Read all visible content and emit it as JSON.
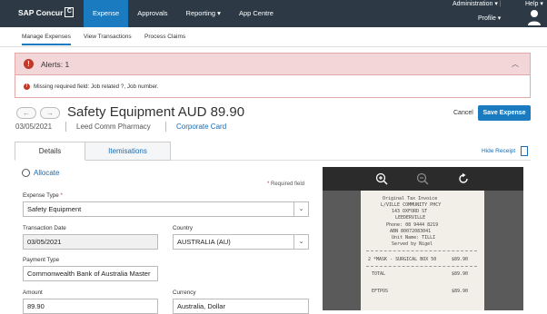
{
  "topbar": {
    "logo_text": "SAP Concur",
    "logo_mark": "C",
    "nav": [
      {
        "label": "Expense",
        "active": true
      },
      {
        "label": "Approvals",
        "active": false
      },
      {
        "label": "Reporting",
        "active": false
      },
      {
        "label": "App Centre",
        "active": false
      }
    ],
    "admin_label": "Administration",
    "help_label": "Help",
    "profile_label": "Profile",
    "accent": "#1a7bc1",
    "background": "#2d3a45"
  },
  "subnav": {
    "items": [
      "Manage Expenses",
      "View Transactions",
      "Process Claims"
    ],
    "active_index": 0
  },
  "alert": {
    "title": "Alerts: 1",
    "message": "Missing required field: Job related ?, Job number.",
    "color": "#c0392b"
  },
  "expense": {
    "title": "Safety Equipment AUD 89.90",
    "date": "03/05/2021",
    "vendor": "Leed Comm Pharmacy",
    "payment": "Corporate Card",
    "cancel_label": "Cancel",
    "save_label": "Save Expense"
  },
  "tabs": {
    "details": "Details",
    "itemisations": "Itemisations",
    "hide_receipt": "Hide Receipt"
  },
  "form": {
    "allocate_label": "Allocate",
    "required_note": "Required field",
    "expense_type_label": "Expense Type",
    "expense_type_value": "Safety Equipment",
    "transaction_date_label": "Transaction Date",
    "transaction_date_value": "03/05/2021",
    "country_label": "Country",
    "country_value": "AUSTRALIA (AU)",
    "payment_type_label": "Payment Type",
    "payment_type_value": "Commonwealth Bank of Australia Master",
    "amount_label": "Amount",
    "amount_value": "89.90",
    "currency_label": "Currency",
    "currency_value": "Australia, Dollar"
  },
  "receipt": {
    "lines": [
      "Original Tax Invoice",
      "L/VILLE COMMUNITY PHCY",
      "143 OXFORD ST",
      "LEEDERVILLE",
      "Phone: 08 9444 8219",
      "ABN 80072083041",
      "Unit Name: TILLI",
      "Served by Nigel"
    ],
    "item_line": "2 *MASK - SURGICAL BOX 50",
    "item_amount": "$89.90",
    "total_label": "TOTAL",
    "total_amount": "$89.90",
    "footer_label": "EFTPOS",
    "footer_amount": "$89.90"
  }
}
